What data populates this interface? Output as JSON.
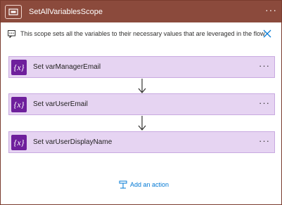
{
  "scope": {
    "title": "SetAllVariablesScope",
    "more": "…",
    "description": "This scope sets all the variables to their necessary values that are leveraged in the flow",
    "header_color": "#8b4a3c",
    "border_color": "#7a3b2e"
  },
  "actions": [
    {
      "label": "Set varManagerEmail",
      "more": "···",
      "icon": "variable-icon"
    },
    {
      "label": "Set varUserEmail",
      "more": "···",
      "icon": "variable-icon"
    },
    {
      "label": "Set varUserDisplayName",
      "more": "···",
      "icon": "variable-icon"
    }
  ],
  "add_action": {
    "label": "Add an action",
    "color": "#0078d4"
  },
  "colors": {
    "action_bg": "#e6d4f2",
    "action_icon_bg": "#6e1f9c"
  }
}
